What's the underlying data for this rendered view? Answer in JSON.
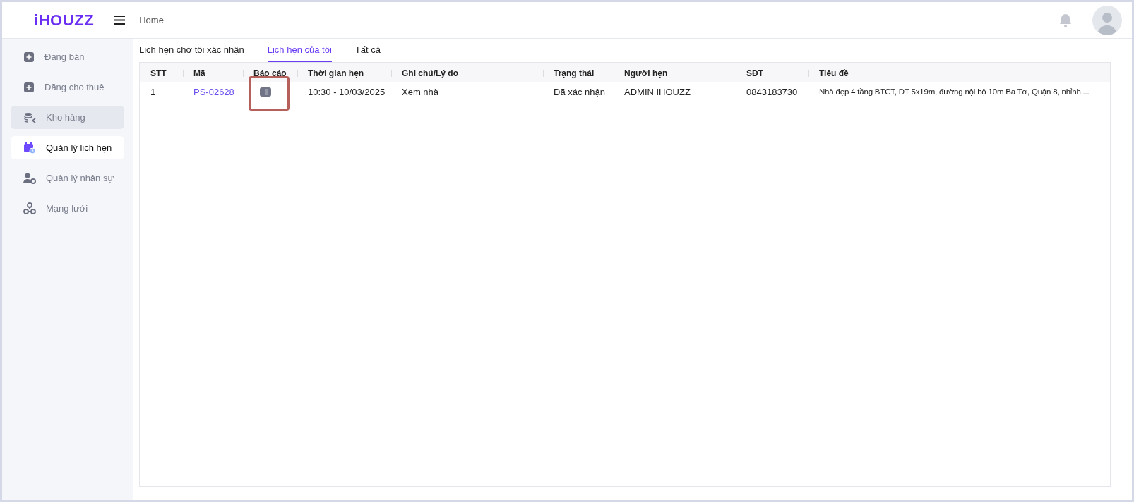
{
  "header": {
    "logo": "iHOUZZ",
    "breadcrumb": "Home"
  },
  "sidebar": {
    "items": [
      {
        "label": "Đăng bán",
        "kind": "plus",
        "selected": false,
        "hovered": false
      },
      {
        "label": "Đăng cho thuê",
        "kind": "plus",
        "selected": false,
        "hovered": false
      },
      {
        "label": "Kho hàng",
        "kind": "stack",
        "selected": false,
        "hovered": true
      },
      {
        "label": "Quản lý lịch hẹn",
        "kind": "calendar",
        "selected": true,
        "hovered": false
      },
      {
        "label": "Quản lý nhân sự",
        "kind": "staff",
        "selected": false,
        "hovered": false
      },
      {
        "label": "Mạng lưới",
        "kind": "network",
        "selected": false,
        "hovered": false
      }
    ]
  },
  "tabs": [
    {
      "label": "Lịch hẹn chờ tôi xác nhận",
      "selected": false
    },
    {
      "label": "Lịch hẹn của tôi",
      "selected": true
    },
    {
      "label": "Tất cả",
      "selected": false
    }
  ],
  "table": {
    "columns": [
      "STT",
      "Mã",
      "Báo cáo",
      "Thời gian hẹn",
      "Ghi chú/Lý do",
      "Trạng thái",
      "Người hẹn",
      "SĐT",
      "Tiêu đề"
    ],
    "rows": [
      {
        "stt": "1",
        "code": "PS-02628",
        "report_highlighted": true,
        "time": "10:30 - 10/03/2025",
        "note": "Xem nhà",
        "status": "Đã xác nhận",
        "person": "ADMIN IHOUZZ",
        "phone": "0843183730",
        "title": "Nhà đẹp 4 tầng BTCT, DT 5x19m, đường nội bộ 10m Ba Tơ, Quận 8, nhỉnh ..."
      }
    ]
  }
}
